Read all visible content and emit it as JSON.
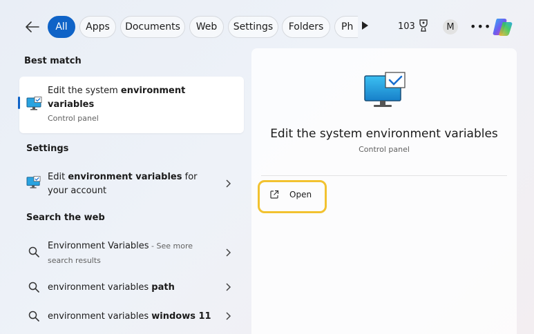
{
  "topbar": {
    "filters": [
      "All",
      "Apps",
      "Documents",
      "Web",
      "Settings",
      "Folders",
      "Ph"
    ],
    "points": "103",
    "avatar_initial": "M",
    "more": "•••"
  },
  "left": {
    "best_match_header": "Best match",
    "best_match": {
      "title_prefix": "Edit the system ",
      "title_bold": "environment",
      "title_line2_bold": "variables",
      "subtitle": "Control panel"
    },
    "settings_header": "Settings",
    "settings_item": {
      "prefix": "Edit ",
      "bold": "environment variables",
      "suffix": " for",
      "line2": "your account"
    },
    "web_header": "Search the web",
    "web_items": [
      {
        "text": "Environment Variables",
        "suffix": " - See more",
        "line2": "search results"
      },
      {
        "text": "environment variables ",
        "bold": "path"
      },
      {
        "text": "environment variables ",
        "bold": "windows 11"
      }
    ]
  },
  "detail": {
    "title": "Edit the system environment variables",
    "subtitle": "Control panel",
    "open_label": "Open"
  },
  "colors": {
    "accent": "#0f63c7",
    "highlight": "#f2c230"
  },
  "icons": [
    "back-arrow-icon",
    "play-icon",
    "trophy-icon",
    "copilot-icon",
    "monitor-check-icon",
    "search-icon",
    "chevron-right-icon",
    "open-external-icon"
  ]
}
